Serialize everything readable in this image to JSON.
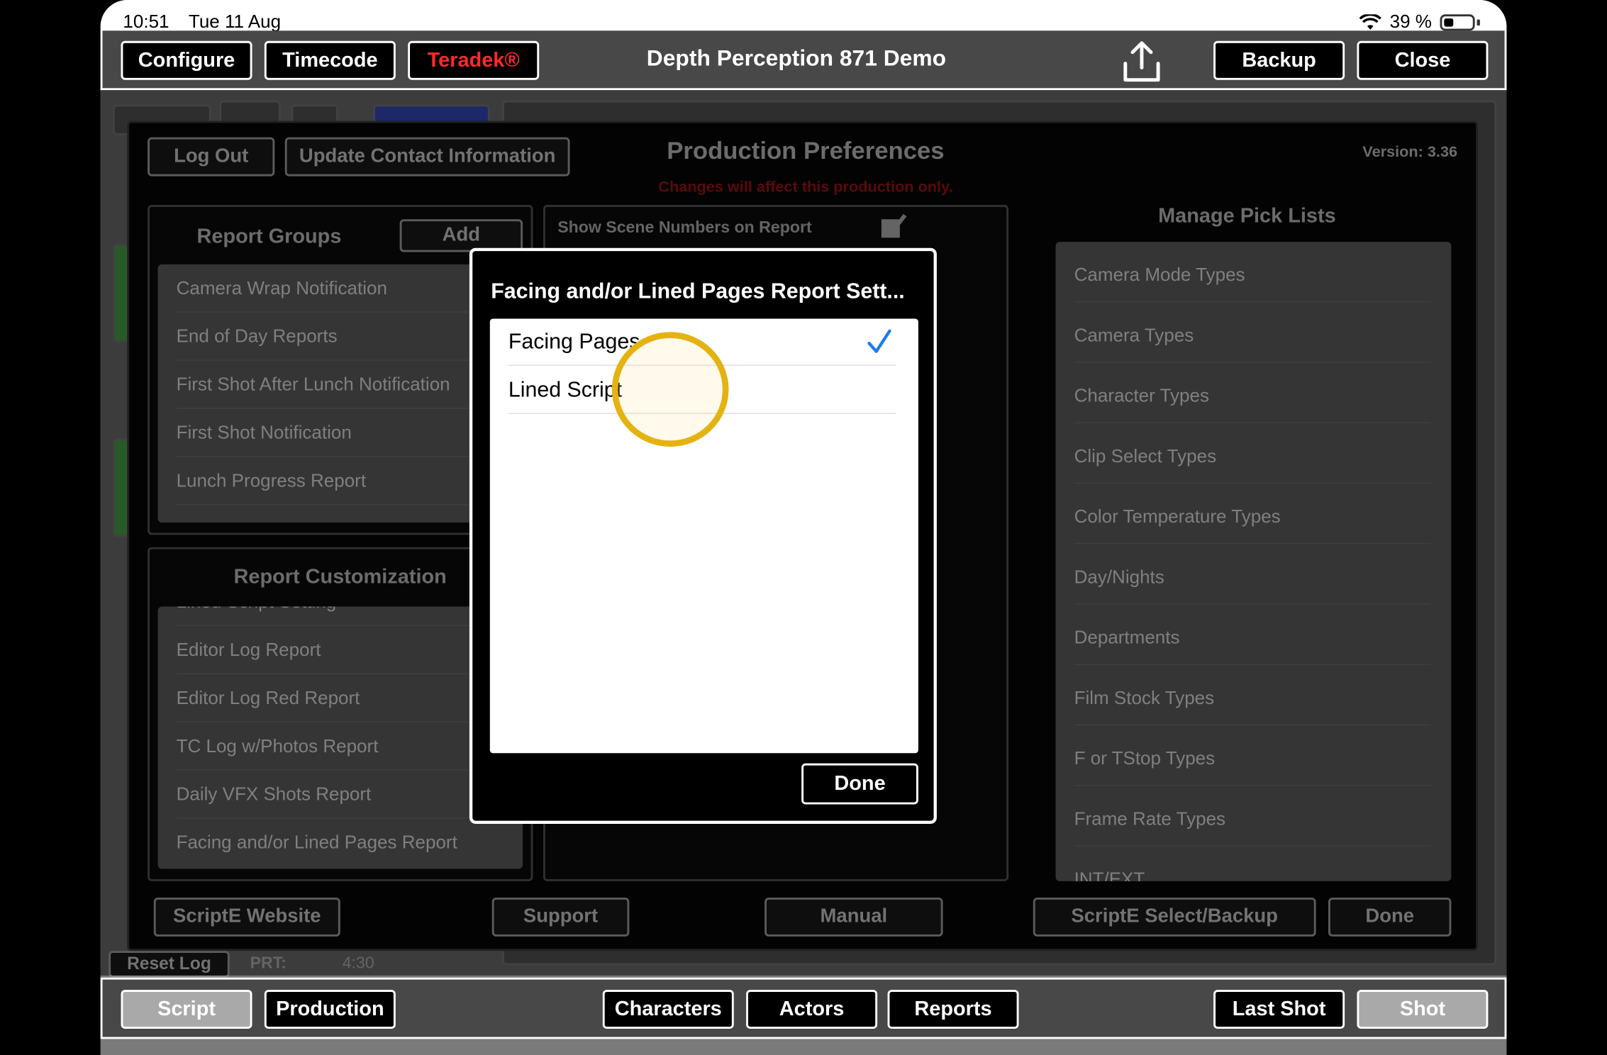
{
  "status": {
    "time": "10:51",
    "date": "Tue 11 Aug",
    "battery": "39 %"
  },
  "topbar": {
    "configure": "Configure",
    "timecode": "Timecode",
    "teradek": "Teradek®",
    "title": "Depth Perception 871 Demo",
    "backup": "Backup",
    "close": "Close",
    "accent_red": "#ff2a2a"
  },
  "prefs": {
    "logout": "Log Out",
    "update_contact": "Update Contact Information",
    "title": "Production Preferences",
    "note": "Changes will affect this production only.",
    "version": "Version: 3.36",
    "show_scene_numbers": "Show Scene Numbers on Report",
    "report_groups": {
      "title": "Report Groups",
      "add": "Add",
      "items": [
        "Camera Wrap Notification",
        "End of Day Reports",
        "First Shot After Lunch Notification",
        "First Shot Notification",
        "Lunch Progress Report"
      ]
    },
    "report_customization": {
      "title": "Report Customization",
      "partial_item": "Lined Script Setting",
      "items": [
        "Editor Log Report",
        "Editor Log Red Report",
        "TC Log w/Photos Report",
        "Daily VFX Shots Report",
        "Facing and/or Lined Pages Report"
      ]
    },
    "pick_lists": {
      "title": "Manage Pick Lists",
      "items": [
        "Camera Mode Types",
        "Camera Types",
        "Character Types",
        "Clip Select Types",
        "Color Temperature Types",
        "Day/Nights",
        "Departments",
        "Film Stock Types",
        "F or TStop Types",
        "Frame Rate Types",
        "INT/EXT"
      ]
    },
    "footer": {
      "website": "ScriptE Website",
      "support": "Support",
      "manual": "Manual",
      "select_backup": "ScriptE Select/Backup",
      "done": "Done"
    }
  },
  "background": {
    "reset_log": "Reset Log",
    "prt_label": "PRT:",
    "prt_value": "4:30"
  },
  "modal": {
    "title": "Facing and/or Lined Pages Report Sett...",
    "options": [
      "Facing Pages",
      "Lined Script"
    ],
    "selected": "Facing Pages",
    "done": "Done",
    "check_color": "#1a7cf0"
  },
  "bottombar": {
    "script": "Script",
    "production": "Production",
    "characters": "Characters",
    "actors": "Actors",
    "reports": "Reports",
    "last_shot": "Last Shot",
    "shot": "Shot"
  }
}
